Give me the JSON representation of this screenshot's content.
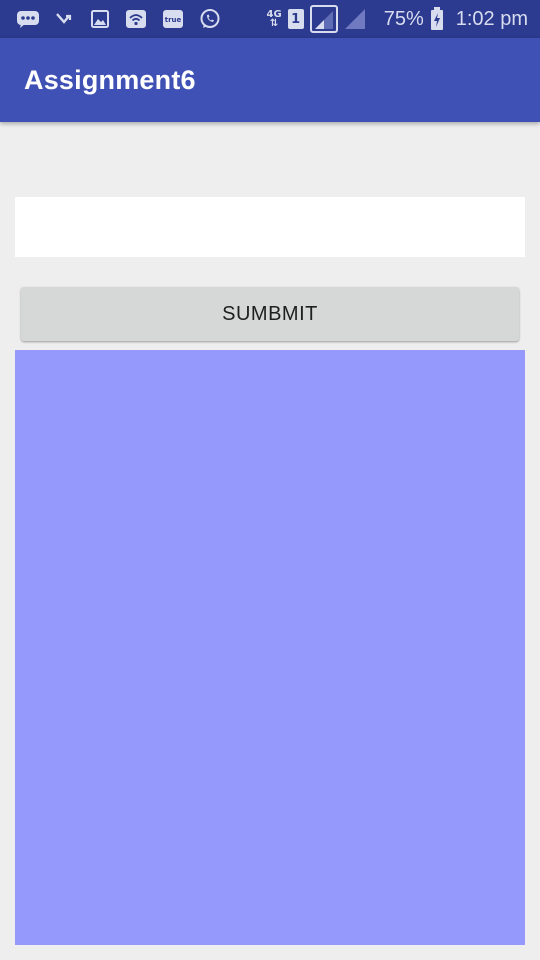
{
  "status_bar": {
    "left_icons": [
      "message-icon",
      "missed-call-icon",
      "gallery-icon",
      "wifi-icon",
      "true-app-icon",
      "whatsapp-icon"
    ],
    "true_label": "true",
    "network_type": "4G",
    "network_arrows": "⇅",
    "sim_slot": "1",
    "battery": "75%",
    "time": "1:02 pm"
  },
  "app_bar": {
    "title": "Assignment6",
    "color": "#3f51b5"
  },
  "input": {
    "value": "",
    "placeholder": ""
  },
  "submit_button": {
    "label": "SUMBMIT"
  },
  "result_panel": {
    "color": "#9599fc"
  }
}
